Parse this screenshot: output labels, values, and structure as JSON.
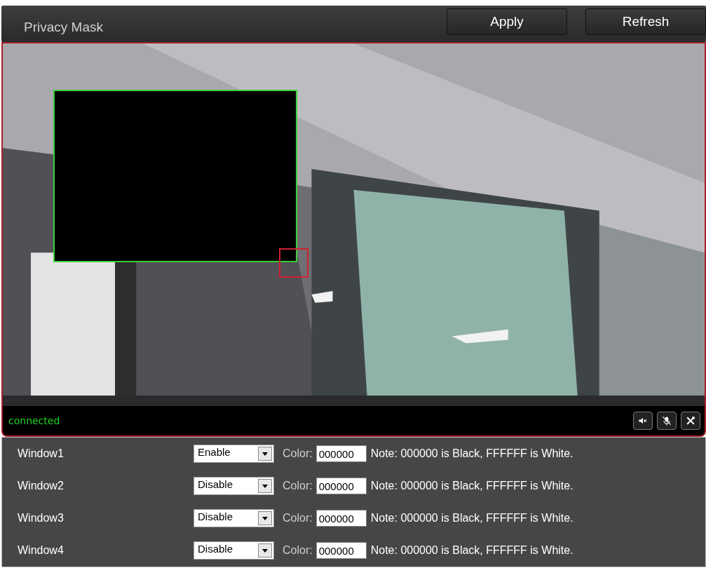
{
  "header": {
    "title": "Privacy Mask",
    "buttons": [
      "Apply",
      "Refresh"
    ]
  },
  "video": {
    "status": "connected",
    "controls": [
      {
        "kind": "mute"
      },
      {
        "kind": "mic-off"
      },
      {
        "kind": "tools"
      }
    ]
  },
  "windows": [
    {
      "label": "Window1",
      "mode": "Enable",
      "color_label": "Color:",
      "color_value": "000000",
      "note": "Note: 000000 is Black, FFFFFF is White."
    },
    {
      "label": "Window2",
      "mode": "Disable",
      "color_label": "Color:",
      "color_value": "000000",
      "note": "Note: 000000 is Black, FFFFFF is White."
    },
    {
      "label": "Window3",
      "mode": "Disable",
      "color_label": "Color:",
      "color_value": "000000",
      "note": "Note: 000000 is Black, FFFFFF is White."
    },
    {
      "label": "Window4",
      "mode": "Disable",
      "color_label": "Color:",
      "color_value": "000000",
      "note": "Note: 000000 is Black, FFFFFF is White."
    }
  ]
}
